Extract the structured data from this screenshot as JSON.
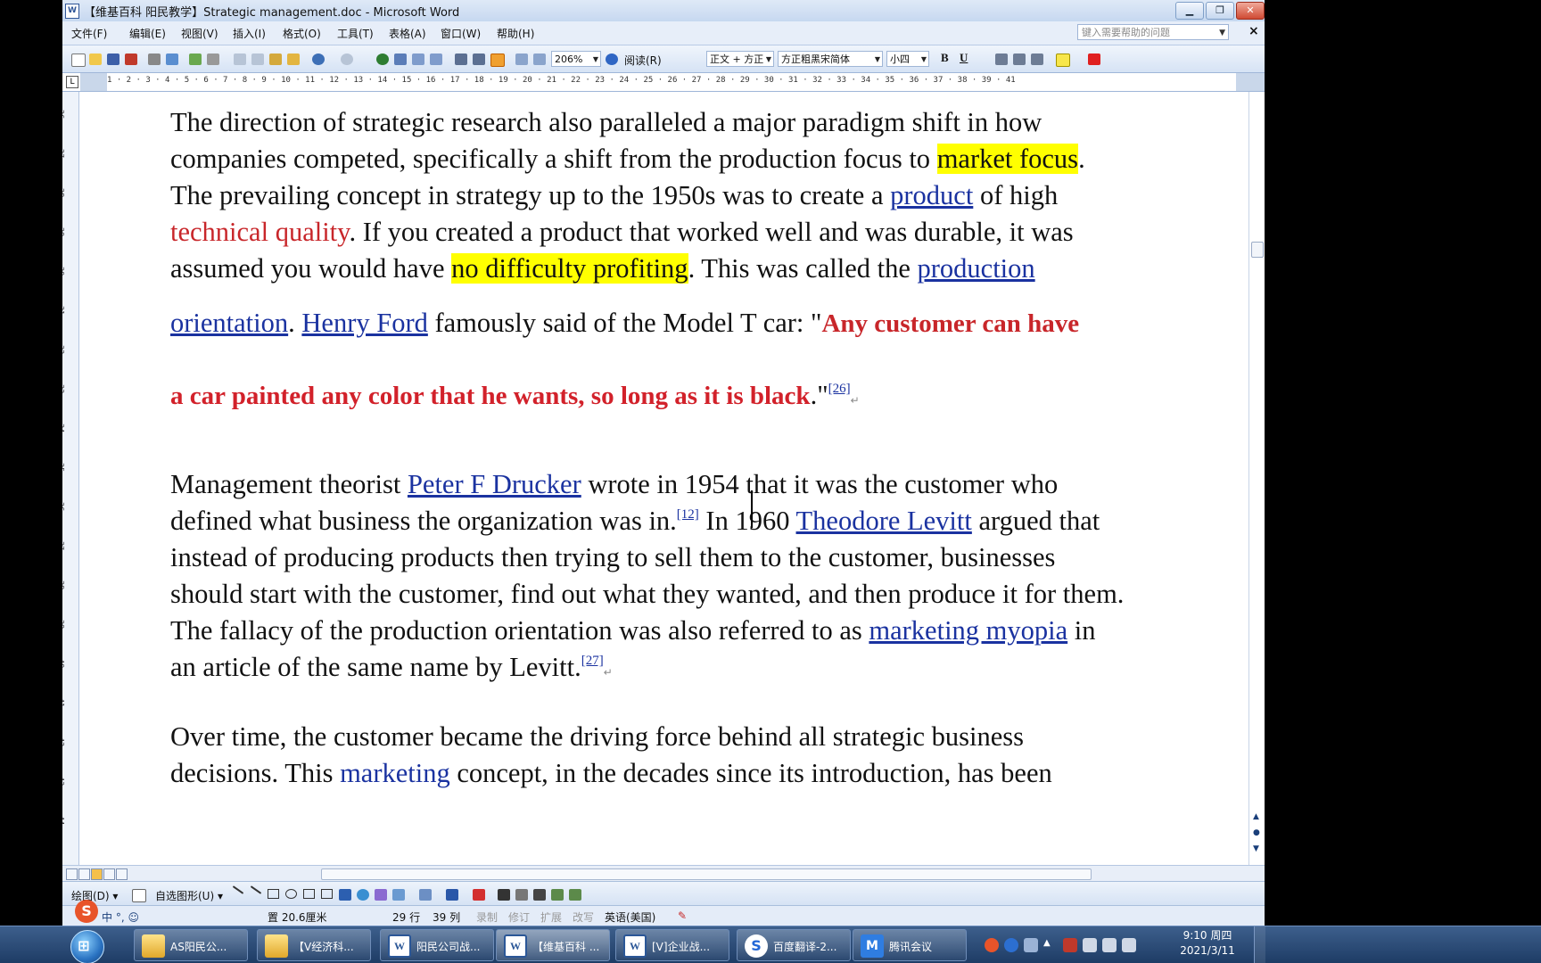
{
  "window": {
    "title": "【维基百科 阳民教学】Strategic management.doc - Microsoft Word",
    "app_icon": "W",
    "buttons": {
      "minimize": "▁",
      "restore": "❐",
      "close": "✕"
    }
  },
  "menubar": {
    "items": [
      "文件(F)",
      "编辑(E)",
      "视图(V)",
      "插入(I)",
      "格式(O)",
      "工具(T)",
      "表格(A)",
      "窗口(W)",
      "帮助(H)"
    ],
    "help_placeholder": "键入需要帮助的问题",
    "close_doc": "×"
  },
  "toolbar": {
    "zoom": "206%",
    "read_mode": "阅读(R)",
    "style": "正文 + 方正",
    "font": "方正粗黑宋简体",
    "size": "小四",
    "bold": "B",
    "underline": "U"
  },
  "ruler": {
    "tab_selector": "L",
    "ticks": "1 · 2 · 3 · 4 · 5 · 6 · 7 · 8 · 9 · 10 · 11 · 12 · 13 · 14 · 15 · 16 · 17 · 18 · 19 · 20 · 21 · 22 · 23 · 24 · 25 · 26 · 27 · 28 · 29 · 30 · 31 · 32 · 33 · 34 · 35 · 36 · 37 · 38 · 39 · 41"
  },
  "vertical_ruler": [
    "26",
    "27",
    "28",
    "29",
    "30",
    "31",
    "32",
    "33",
    "34",
    "35",
    "36",
    "37",
    "38",
    "39",
    "40",
    "41",
    "42",
    "43",
    "44"
  ],
  "document": {
    "line1": "The direction of strategic research also paralleled a major paradigm shift in how",
    "line2_a": "companies competed, specifically a shift from the production focus to ",
    "line2_hl": "market focus",
    "line2_b": ".",
    "line3_a": "The prevailing concept in strategy up to the 1950s was to create a ",
    "line3_link": "product",
    "line3_b": " of high",
    "line4_red": "technical quality",
    "line4_b": ". If you created a product that worked well and was durable, it was",
    "line5_a": "assumed you would have ",
    "line5_hl": "no difficulty profiting",
    "line5_b": ". This was called the ",
    "line5_link": "production ",
    "line6_link1": "orientation",
    "line6_a": ". ",
    "line6_link2": "Henry Ford",
    "line6_b": " famously said of the Model T car: \"",
    "line6_quote": "Any customer can have",
    "line7_quote": "a car painted any color that he wants, so long as it is black",
    "line7_end": ".\"",
    "line7_ref": "[26]",
    "para_mark": "↵",
    "p2_line1_a": "Management theorist ",
    "p2_line1_link": "Peter F Drucker",
    "p2_line1_b": " wrote in 1954 that it was the customer who",
    "p2_line2_a": "defined what business the organization was in.",
    "p2_line2_ref": "[12]",
    "p2_line2_b": " In 1960 ",
    "p2_line2_link": "Theodore Levitt",
    "p2_line2_c": " argued that",
    "p2_line3": "instead of producing products then trying to sell them to the customer, businesses",
    "p2_line4": "should start with the customer, find out what they wanted, and then produce it for them.",
    "p2_line5_a": "The fallacy of the production orientation was also referred to as ",
    "p2_line5_link": "marketing myopia",
    "p2_line5_b": " in",
    "p2_line6_a": "an article of the same name by Levitt.",
    "p2_line6_ref": "[27]",
    "p3_line1": "Over time, the customer became the driving force behind all strategic business",
    "p3_line2_a": "decisions. This ",
    "p3_line2_link": "marketing",
    "p3_line2_b": " concept, in the decades since its introduction, has been"
  },
  "drawbar": {
    "draw": "绘图(D) ▾",
    "autoshapes": "自选图形(U) ▾"
  },
  "statusbar": {
    "position": "置 20.6厘米",
    "line": "29 行",
    "column": "39 列",
    "rec": "录制",
    "trk": "修订",
    "ext": "扩展",
    "ovr": "改写",
    "language": "英语(美国)",
    "ime_label": "中 °, ☺",
    "sogou": "S"
  },
  "taskbar": {
    "tasks": [
      {
        "label": "AS阳民公...",
        "icon": "folder"
      },
      {
        "label": "【V经济科...",
        "icon": "folder"
      },
      {
        "label": "阳民公司战...",
        "icon": "word"
      },
      {
        "label": "【维基百科 ...",
        "icon": "word"
      },
      {
        "label": "[V]企业战...",
        "icon": "word"
      },
      {
        "label": "百度翻译-2...",
        "icon": "baidu"
      },
      {
        "label": "腾讯会议",
        "icon": "meet"
      }
    ],
    "time": "9:10 周四",
    "date": "2021/3/11"
  }
}
